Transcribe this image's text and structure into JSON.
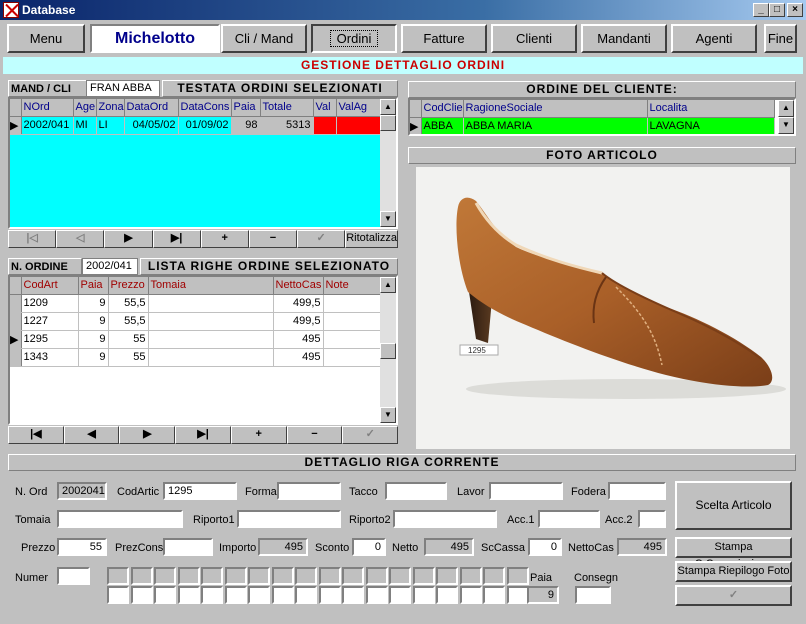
{
  "window": {
    "title": "Database"
  },
  "nav": {
    "menu": "Menu",
    "current": "Michelotto",
    "cli": "Cli / Mand",
    "ordini": "Ordini",
    "fatture": "Fatture",
    "clienti": "Clienti",
    "mandanti": "Mandanti",
    "agenti": "Agenti",
    "fine": "Fine"
  },
  "banner": "GESTIONE DETTAGLIO ORDINI",
  "testata": {
    "mand_label": "MAND / CLI",
    "mand_value": "FRAN  ABBA",
    "title": "TESTATA ORDINI SELEZIONATI",
    "columns": [
      "NOrd",
      "Age",
      "Zona",
      "DataOrd",
      "DataCons",
      "Paia",
      "Totale",
      "Val",
      "ValAg"
    ],
    "rows": [
      [
        "2002/041",
        "MI",
        "LI",
        "04/05/02",
        "01/09/02",
        "98",
        "5313",
        "",
        ""
      ]
    ],
    "nav": [
      "|◁",
      "◁",
      "▶",
      "▶|",
      "+",
      "−",
      "✓",
      "Ritotalizza"
    ]
  },
  "righe": {
    "label": "N. ORDINE",
    "value": "2002/041",
    "title": "LISTA RIGHE ORDINE SELEZIONATO",
    "columns": [
      "CodArt",
      "Paia",
      "Prezzo",
      "Tomaia",
      "NettoCas",
      "Note"
    ],
    "rows": [
      [
        "1209",
        "9",
        "55,5",
        "",
        "499,5",
        ""
      ],
      [
        "1227",
        "9",
        "55,5",
        "",
        "499,5",
        ""
      ],
      [
        "1295",
        "9",
        "55",
        "",
        "495",
        ""
      ],
      [
        "1343",
        "9",
        "55",
        "",
        "495",
        ""
      ]
    ],
    "nav": [
      "|◀",
      "◀",
      "▶",
      "▶|",
      "+",
      "−",
      "✓"
    ]
  },
  "cliente": {
    "title": "ORDINE DEL CLIENTE:",
    "columns": [
      "CodClie",
      "RagioneSociale",
      "Localita"
    ],
    "rows": [
      [
        "ABBA",
        "ABBA MARIA",
        "LAVAGNA"
      ]
    ]
  },
  "foto": {
    "title": "FOTO ARTICOLO",
    "tag": "1295"
  },
  "dettaglio": {
    "title": "DETTAGLIO RIGA CORRENTE",
    "nord_label": "N. Ord",
    "nord": "2002041",
    "codartic_label": "CodArtic",
    "codartic": "1295",
    "forma_label": "Forma",
    "forma": "",
    "tacco_label": "Tacco",
    "tacco": "",
    "lavor_label": "Lavor",
    "lavor": "",
    "fodera_label": "Fodera",
    "fodera": "",
    "tomaia_label": "Tomaia",
    "tomaia": "",
    "riporto1_label": "Riporto1",
    "riporto1": "",
    "riporto2_label": "Riporto2",
    "riporto2": "",
    "acc1_label": "Acc.1",
    "acc1": "",
    "acc2_label": "Acc.2",
    "acc2": "",
    "prezzo_label": "Prezzo",
    "prezzo": "55",
    "prezcons_label": "PrezCons",
    "prezcons": "",
    "importo_label": "Importo",
    "importo": "495",
    "sconto_label": "Sconto",
    "sconto": "0",
    "netto_label": "Netto",
    "netto": "495",
    "sccassa_label": "ScCassa",
    "sccassa": "0",
    "nettocas_label": "NettoCas",
    "nettocas": "495",
    "numer_label": "Numer",
    "numer": "",
    "paia_label": "Paia",
    "paia": "9",
    "consegn_label": "Consegn",
    "consegn": "",
    "btn_scelta": "Scelta Articolo",
    "btn_stampa_comm": "Stampa C.Commissione",
    "btn_stampa_foto": "Stampa Riepilogo Foto",
    "btn_ok": "✓"
  }
}
